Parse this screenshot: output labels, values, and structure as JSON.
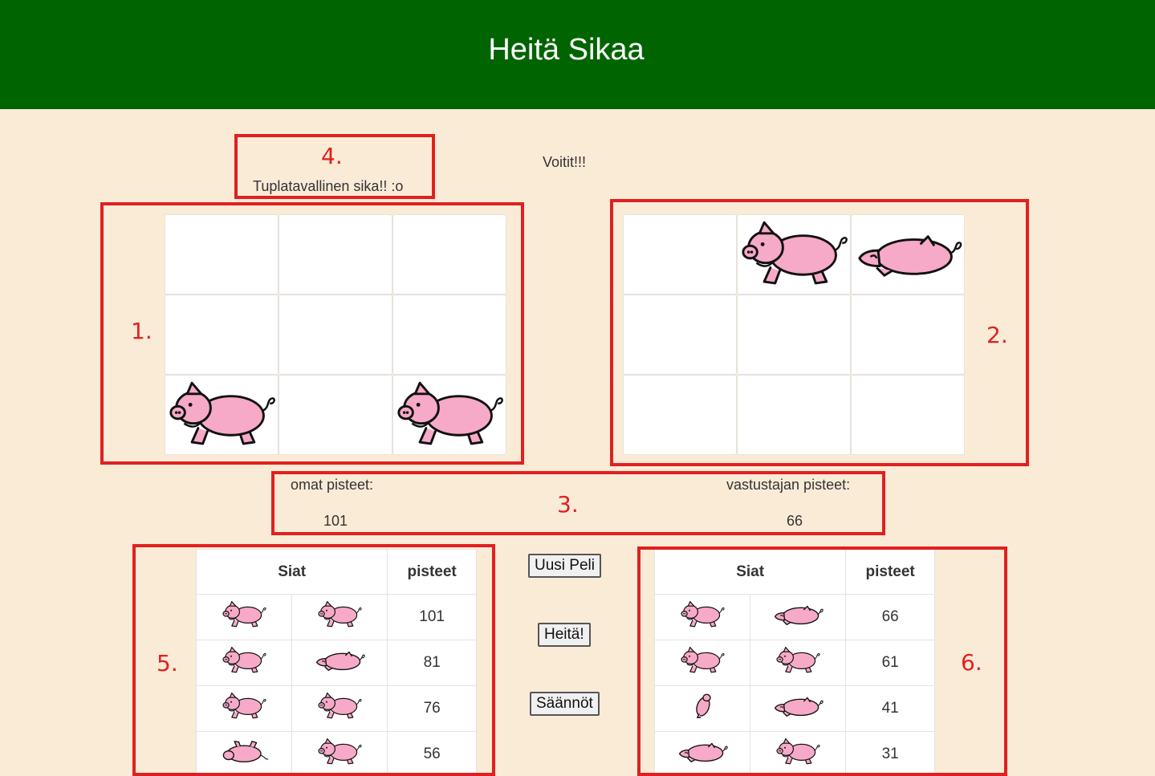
{
  "header": {
    "title": "Heitä Sikaa"
  },
  "messages": {
    "roll_message": "Tuplatavallinen sika!! :o",
    "result_message": "Voitit!!!"
  },
  "annotations": [
    "1.",
    "2.",
    "3.",
    "4.",
    "5.",
    "6."
  ],
  "boards": {
    "player": [
      "empty",
      "empty",
      "empty",
      "empty",
      "empty",
      "empty",
      "pig-side",
      "empty",
      "pig-side"
    ],
    "opponent": [
      "empty",
      "pig-side",
      "pig-back",
      "empty",
      "empty",
      "empty",
      "empty",
      "empty",
      "empty"
    ]
  },
  "scores": {
    "own_label": "omat pisteet:",
    "own_value": "101",
    "opponent_label": "vastustajan pisteet:",
    "opponent_value": "66"
  },
  "buttons": {
    "new_game": "Uusi Peli",
    "throw": "Heitä!",
    "rules": "Säännöt"
  },
  "history": {
    "col_pigs": "Siat",
    "col_points": "pisteet",
    "player_rows": [
      {
        "pig1": "pig-side",
        "pig2": "pig-side",
        "points": "101"
      },
      {
        "pig1": "pig-side",
        "pig2": "pig-back",
        "points": "81"
      },
      {
        "pig1": "pig-side",
        "pig2": "pig-side",
        "points": "76"
      },
      {
        "pig1": "pig-upside",
        "pig2": "pig-side",
        "points": "56"
      }
    ],
    "opponent_rows": [
      {
        "pig1": "pig-side",
        "pig2": "pig-back",
        "points": "66"
      },
      {
        "pig1": "pig-side",
        "pig2": "pig-side",
        "points": "61"
      },
      {
        "pig1": "pig-stand",
        "pig2": "pig-back",
        "points": "41"
      },
      {
        "pig1": "pig-back",
        "pig2": "pig-side",
        "points": "31"
      }
    ]
  },
  "colors": {
    "header_bg": "#006400",
    "page_bg": "#faebd7",
    "annotation": "#e02020",
    "pig_pink": "#f7a9c8"
  }
}
